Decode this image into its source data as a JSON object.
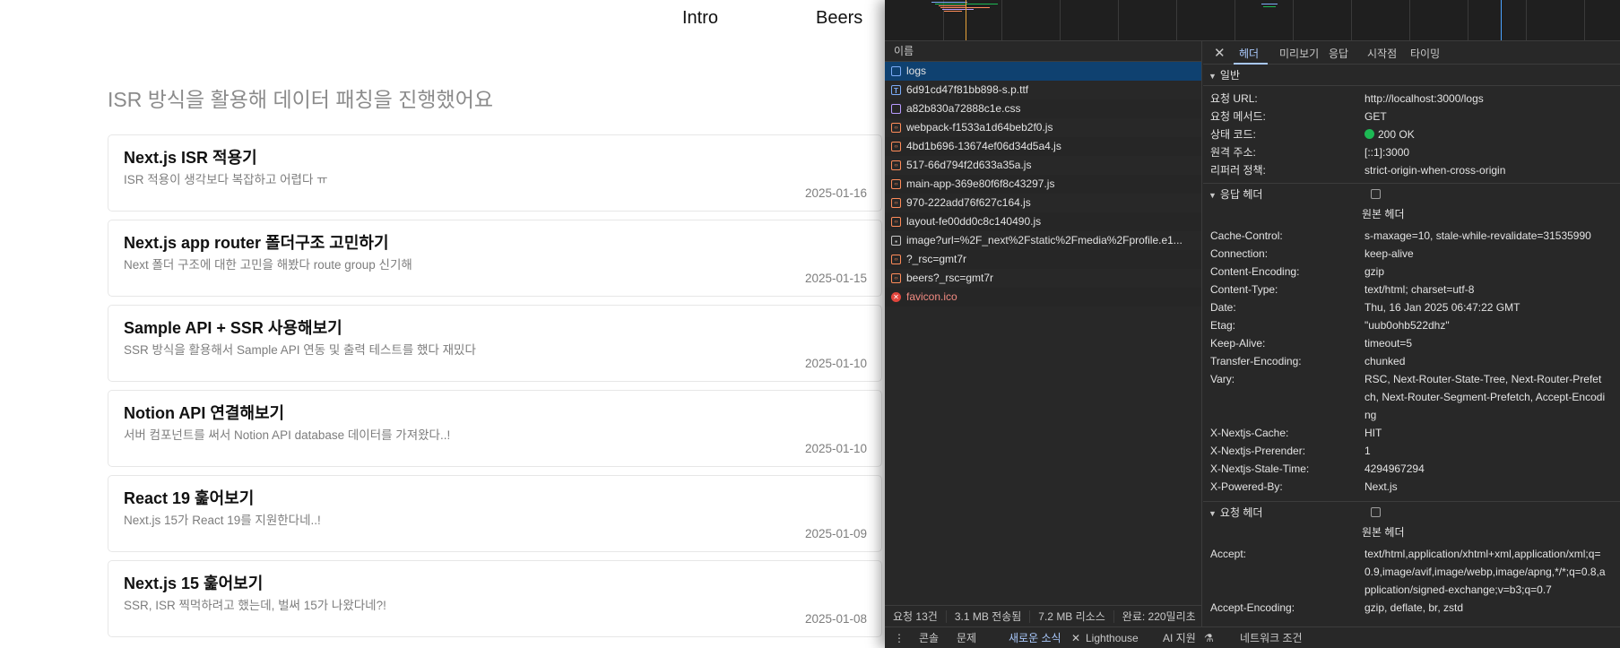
{
  "site": {
    "nav": {
      "intro": "Intro",
      "beers": "Beers"
    },
    "heading": "ISR 방식을 활용해 데이터 패칭을 진행했어요",
    "posts": [
      {
        "title": "Next.js ISR 적용기",
        "desc": "ISR 적용이 생각보다 복잡하고 어렵다 ㅠ",
        "date": "2025-01-16"
      },
      {
        "title": "Next.js app router 폴더구조 고민하기",
        "desc": "Next 폴더 구조에 대한 고민을 해봤다 route group 신기해",
        "date": "2025-01-15"
      },
      {
        "title": "Sample API + SSR 사용해보기",
        "desc": "SSR 방식을 활용해서 Sample API 연동 및 출력 테스트를 했다 재밌다",
        "date": "2025-01-10"
      },
      {
        "title": "Notion API 연결해보기",
        "desc": "서버 컴포넌트를 써서 Notion API database 데이터를 가져왔다..!",
        "date": "2025-01-10"
      },
      {
        "title": "React 19 훑어보기",
        "desc": "Next.js 15가 React 19를 지원한다네..!",
        "date": "2025-01-09"
      },
      {
        "title": "Next.js 15 훑어보기",
        "desc": "SSR, ISR 찍먹하려고 했는데, 벌써 15가 나왔다네?!",
        "date": "2025-01-08"
      }
    ]
  },
  "devtools": {
    "colors": {
      "selected_row": "#0f4170",
      "active_tab": "#a8c7fa",
      "status_ok": "#1db954",
      "error": "#e2453c"
    },
    "requests": {
      "column_name": "이름",
      "rows": [
        {
          "name": "logs",
          "icon": "document-icon",
          "type": "doc",
          "selected": true
        },
        {
          "name": "6d91cd47f81bb898-s.p.ttf",
          "icon": "font-icon",
          "type": "font"
        },
        {
          "name": "a82b830a72888c1e.css",
          "icon": "stylesheet-icon",
          "type": "css"
        },
        {
          "name": "webpack-f1533a1d64beb2f0.js",
          "icon": "script-icon",
          "type": "js"
        },
        {
          "name": "4bd1b696-13674ef06d34d5a4.js",
          "icon": "script-icon",
          "type": "js"
        },
        {
          "name": "517-66d794f2d633a35a.js",
          "icon": "script-icon",
          "type": "js"
        },
        {
          "name": "main-app-369e80f6f8c43297.js",
          "icon": "script-icon",
          "type": "js"
        },
        {
          "name": "970-222add76f627c164.js",
          "icon": "script-icon",
          "type": "js"
        },
        {
          "name": "layout-fe00dd0c8c140490.js",
          "icon": "script-icon",
          "type": "js"
        },
        {
          "name": "image?url=%2F_next%2Fstatic%2Fmedia%2Fprofile.e1...",
          "icon": "image-icon",
          "type": "img"
        },
        {
          "name": "?_rsc=gmt7r",
          "icon": "script-icon",
          "type": "js"
        },
        {
          "name": "beers?_rsc=gmt7r",
          "icon": "script-icon",
          "type": "js"
        },
        {
          "name": "favicon.ico",
          "icon": "error-icon",
          "type": "err",
          "error": true
        }
      ],
      "summary": {
        "count": "요청 13건",
        "transferred": "3.1 MB 전송됨",
        "resources": "7.2 MB 리소스",
        "finish": "완료: 220밀리초"
      }
    },
    "detail": {
      "tabs": [
        "헤더",
        "미리보기",
        "응답",
        "시작점",
        "타이밍"
      ],
      "active_tab": "헤더",
      "general": {
        "title": "일반",
        "items": [
          {
            "k": "요청 URL:",
            "v": "http://localhost:3000/logs"
          },
          {
            "k": "요청 메서드:",
            "v": "GET"
          },
          {
            "k": "상태 코드:",
            "v": "200 OK"
          },
          {
            "k": "원격 주소:",
            "v": "[::1]:3000"
          },
          {
            "k": "리퍼러 정책:",
            "v": "strict-origin-when-cross-origin"
          }
        ]
      },
      "response_headers": {
        "title": "응답 헤더",
        "raw_label": "원본 헤더",
        "items": [
          {
            "k": "Cache-Control:",
            "v": "s-maxage=10, stale-while-revalidate=31535990"
          },
          {
            "k": "Connection:",
            "v": "keep-alive"
          },
          {
            "k": "Content-Encoding:",
            "v": "gzip"
          },
          {
            "k": "Content-Type:",
            "v": "text/html; charset=utf-8"
          },
          {
            "k": "Date:",
            "v": "Thu, 16 Jan 2025 06:47:22 GMT"
          },
          {
            "k": "Etag:",
            "v": "\"uub0ohb522dhz\""
          },
          {
            "k": "Keep-Alive:",
            "v": "timeout=5"
          },
          {
            "k": "Transfer-Encoding:",
            "v": "chunked"
          },
          {
            "k": "Vary:",
            "v": "RSC, Next-Router-State-Tree, Next-Router-Prefetch, Next-Router-Segment-Prefetch, Accept-Encoding"
          },
          {
            "k": "X-Nextjs-Cache:",
            "v": "HIT"
          },
          {
            "k": "X-Nextjs-Prerender:",
            "v": "1"
          },
          {
            "k": "X-Nextjs-Stale-Time:",
            "v": "4294967294"
          },
          {
            "k": "X-Powered-By:",
            "v": "Next.js"
          }
        ]
      },
      "request_headers": {
        "title": "요청 헤더",
        "raw_label": "원본 헤더",
        "items": [
          {
            "k": "Accept:",
            "v": "text/html,application/xhtml+xml,application/xml;q=0.9,image/avif,image/webp,image/apng,*/*;q=0.8,application/signed-exchange;v=b3;q=0.7"
          },
          {
            "k": "Accept-Encoding:",
            "v": "gzip, deflate, br, zstd"
          }
        ]
      }
    },
    "drawer": {
      "tabs": [
        {
          "label": "콘솔"
        },
        {
          "label": "문제"
        },
        {
          "label": "새로운 소식",
          "active": true
        },
        {
          "label": "Lighthouse"
        },
        {
          "label": "AI 지원"
        },
        {
          "label": "네트워크 조건"
        }
      ]
    }
  }
}
